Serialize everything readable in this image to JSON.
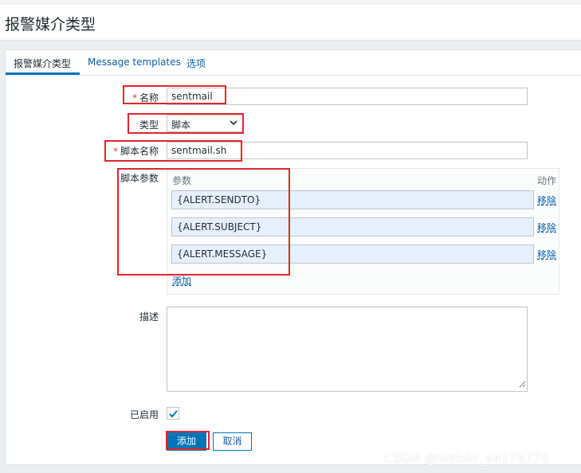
{
  "page": {
    "title": "报警媒介类型"
  },
  "tabs": [
    {
      "label": "报警媒介类型"
    },
    {
      "label": "Message templates"
    },
    {
      "label": "选项"
    }
  ],
  "form": {
    "name": {
      "label": "名称",
      "value": "sentmail"
    },
    "type": {
      "label": "类型",
      "value": "脚本"
    },
    "script_name": {
      "label": "脚本名称",
      "value": "sentmail.sh"
    },
    "script_params": {
      "label": "脚本参数",
      "col_param": "参数",
      "col_action": "动作",
      "params": [
        {
          "value": "{ALERT.SENDTO}",
          "remove_label": "移除"
        },
        {
          "value": "{ALERT.SUBJECT}",
          "remove_label": "移除"
        },
        {
          "value": "{ALERT.MESSAGE}",
          "remove_label": "移除"
        }
      ],
      "add_label": "添加"
    },
    "description": {
      "label": "描述",
      "value": ""
    },
    "enabled": {
      "label": "已启用",
      "checked": true
    }
  },
  "buttons": {
    "add": "添加",
    "cancel": "取消"
  },
  "watermark": "CSDN @weixin_44178770",
  "colors": {
    "accent": "#0275b8",
    "highlight_box": "#e0262f",
    "param_field_bg": "#e8effc"
  }
}
